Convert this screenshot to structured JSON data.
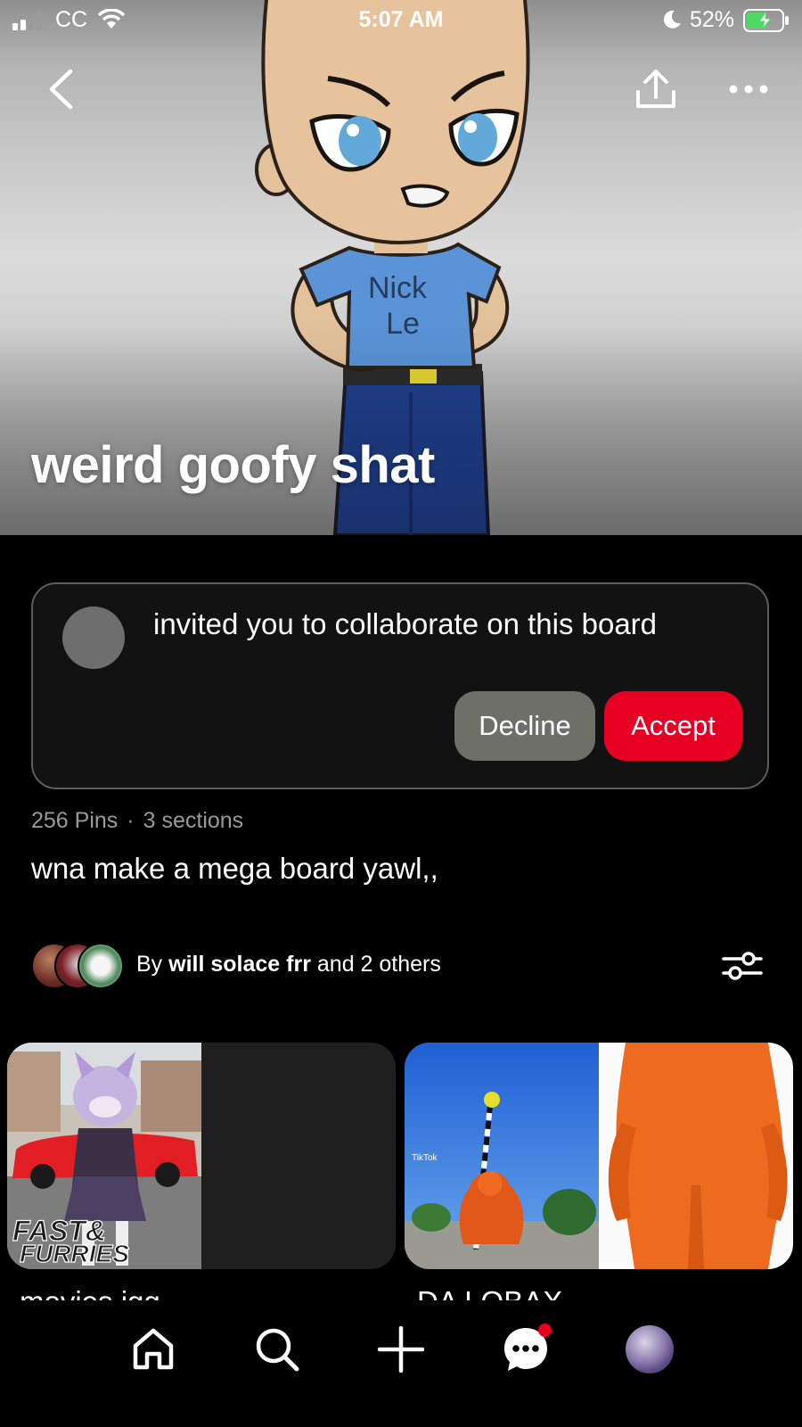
{
  "status_bar": {
    "carrier": "CC",
    "time": "5:07 AM",
    "battery_percent": "52%"
  },
  "header": {
    "board_title": "weird goofy shat",
    "hero_shirt_text_line1": "Nick",
    "hero_shirt_text_line2": "Le"
  },
  "invite": {
    "message": "invited you to collaborate on this board",
    "decline_label": "Decline",
    "accept_label": "Accept"
  },
  "board": {
    "pins_count": "256 Pins",
    "separator": "·",
    "sections_count": "3 sections",
    "description": "wna make a mega board yawl,,"
  },
  "collaborators": {
    "prefix": "By",
    "owner": "will solace frr",
    "suffix": "and 2 others"
  },
  "sections": [
    {
      "label": "movies igg",
      "thumb_text_1": "FAST&",
      "thumb_text_2": "FURRIES"
    },
    {
      "label": "DA LOBAX",
      "thumb_text": "TikTok"
    }
  ],
  "colors": {
    "accent_red": "#e60023",
    "decline_gray": "#6f6f6a",
    "card_bg": "#121212"
  },
  "nav": [
    "home-icon",
    "search-icon",
    "create-icon",
    "messages-icon",
    "profile-avatar"
  ]
}
